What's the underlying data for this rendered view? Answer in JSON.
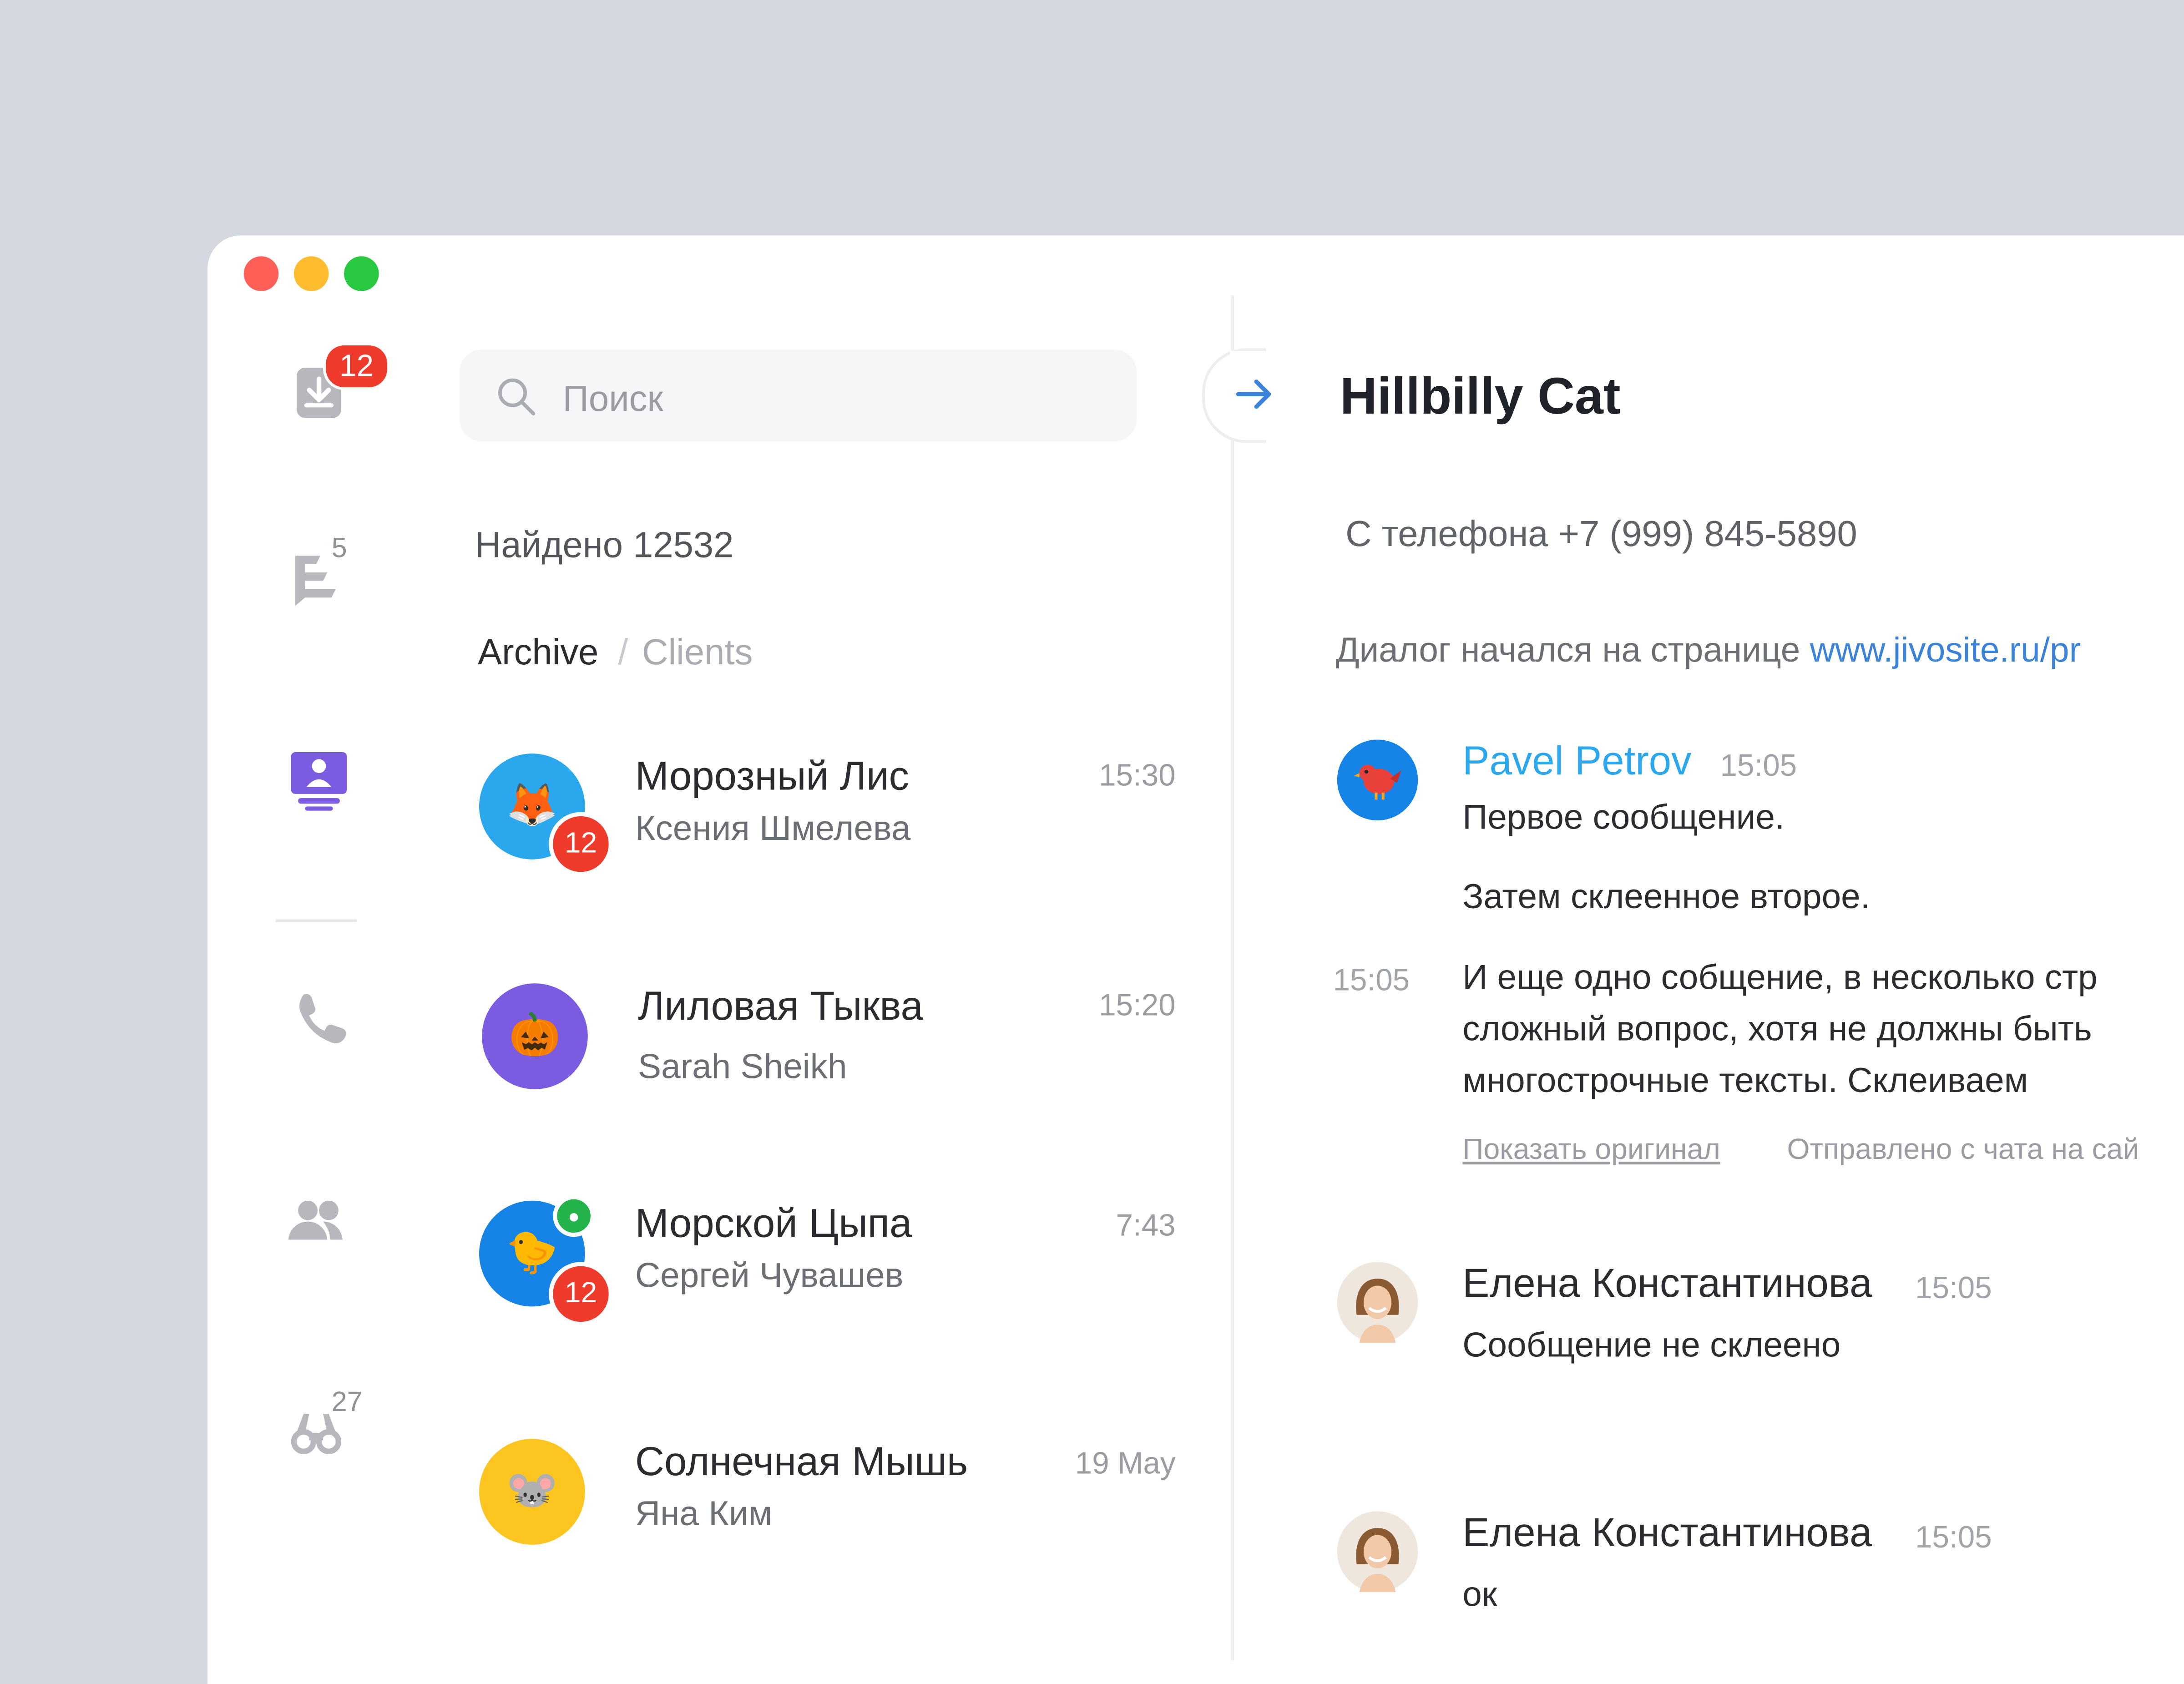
{
  "sidebar": {
    "inbox_badge": "12",
    "chats_count": "5",
    "visitors_count": "27"
  },
  "search": {
    "placeholder": "Поиск"
  },
  "results": {
    "found_label": "Найдено 12532",
    "crumb_active": "Archive",
    "crumb_sep": "/",
    "crumb_inactive": "Clients"
  },
  "contacts": [
    {
      "name": "Морозный Лис",
      "subtitle": "Ксения Шмелева",
      "time": "15:30",
      "badge": "12",
      "emoji": "🦊",
      "color": "#2ba7ee"
    },
    {
      "name": "Лиловая Тыква",
      "subtitle": "Sarah Sheikh",
      "time": "15:20",
      "emoji": "🎃",
      "color": "#7b5ce0"
    },
    {
      "name": "Морской Цыпа",
      "subtitle": "Сергей Чувашев",
      "time": "7:43",
      "badge": "12",
      "emoji": "🐤",
      "color": "#1683e6"
    },
    {
      "name": "Солнечная Мышь",
      "subtitle": "Яна Ким",
      "time": "19 May",
      "emoji": "🐭",
      "color": "#fcc51f"
    }
  ],
  "chat": {
    "title": "Hillbilly Cat",
    "phone": "С телефона +7 (999) 845-5890",
    "dialog_prefix": "Диалог начался на странице",
    "dialog_url": "www.jivosite.ru/pr",
    "messages": [
      {
        "author": "Pavel Petrov",
        "time": "15:05",
        "lines": [
          "Первое сообщение.",
          "Затем склеенное второе."
        ],
        "glued_time": "15:05",
        "glued_lines": [
          "И еще одно собщение, в несколько стр",
          "сложный вопрос, хотя не должны быть",
          "многострочные тексты. Склеиваем"
        ],
        "show_original": "Показать оригинал",
        "sent_from": "Отправлено с чата на сай"
      },
      {
        "author": "Елена Константинова",
        "time": "15:05",
        "text": "Сообщение не склеено"
      },
      {
        "author": "Елена Константинова",
        "time": "15:05",
        "text": "ок"
      }
    ]
  },
  "colors": {
    "background": "#d5d8e0",
    "accent": "#3b82d9",
    "author_agent": "#2ba7ee",
    "badge": "#ee3b2b",
    "active_nav": "#7b5ce0"
  }
}
